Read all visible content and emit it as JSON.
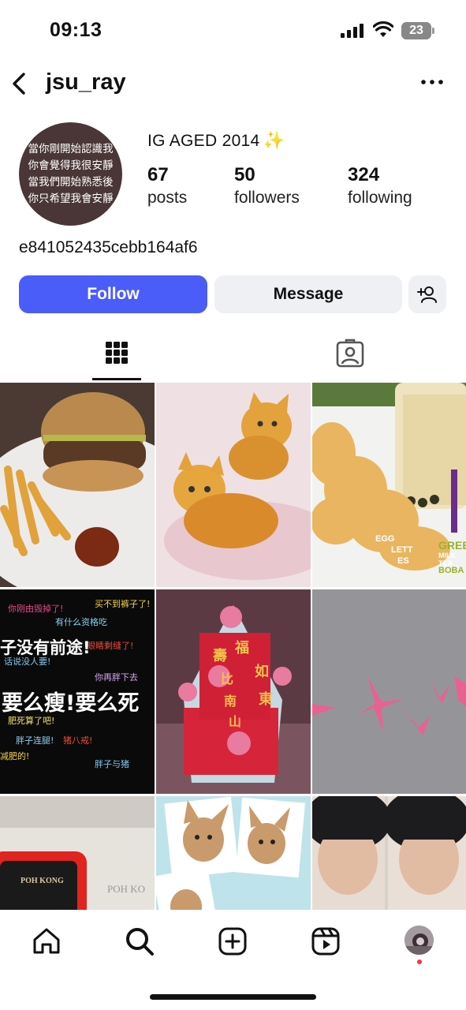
{
  "status_bar": {
    "time": "09:13",
    "battery_level": "23",
    "icons": [
      "signal-icon",
      "wifi-icon",
      "battery-icon"
    ]
  },
  "header": {
    "back_icon": "chevron-left-icon",
    "username": "jsu_ray",
    "more_icon": "more-horizontal-icon"
  },
  "profile": {
    "avatar_lines": [
      "當你剛開始認識我",
      "你會覺得我很安靜",
      "當我們開始熟悉後",
      "你只希望我會安靜"
    ],
    "bio_title": "IG AGED 2014",
    "bio_emoji": "✨",
    "stats": [
      {
        "value": "67",
        "label": "posts"
      },
      {
        "value": "50",
        "label": "followers"
      },
      {
        "value": "324",
        "label": "following"
      }
    ],
    "bio_text": "e841052435cebb164af6"
  },
  "actions": {
    "follow_label": "Follow",
    "message_label": "Message",
    "add_user_icon": "add-user-icon"
  },
  "tabs": [
    {
      "icon": "grid-icon",
      "active": true
    },
    {
      "icon": "tagged-icon",
      "active": false
    }
  ],
  "posts": [
    {
      "subject": "burger and fries",
      "captions": []
    },
    {
      "subject": "two orange kittens",
      "captions": []
    },
    {
      "subject": "egg waffle and milk tea",
      "captions": [
        "EGG",
        "LETT",
        "ES",
        "GREEN",
        "MILK TEA",
        "BOBA"
      ]
    },
    {
      "subject": "chinese text poster",
      "captions": [
        "要么瘦!要么死",
        "子没有前途!"
      ]
    },
    {
      "subject": "red envelope decoration",
      "captions": [
        "福",
        "如",
        "東",
        "壽",
        "比",
        "南",
        "山"
      ]
    },
    {
      "subject": "pink flowers on pavement",
      "captions": []
    },
    {
      "subject": "red box",
      "captions": [
        "POH KONG",
        "POH KO"
      ]
    },
    {
      "subject": "chihuahua photos",
      "captions": []
    },
    {
      "subject": "selfie photos",
      "captions": []
    }
  ],
  "bottom_nav": [
    {
      "icon": "home-icon"
    },
    {
      "icon": "search-icon"
    },
    {
      "icon": "create-icon"
    },
    {
      "icon": "reels-icon"
    },
    {
      "icon": "profile-avatar-icon"
    }
  ],
  "colors": {
    "follow_button": "#4a5df9",
    "secondary_button": "#eff0f3",
    "notification_dot": "#ff3040"
  }
}
